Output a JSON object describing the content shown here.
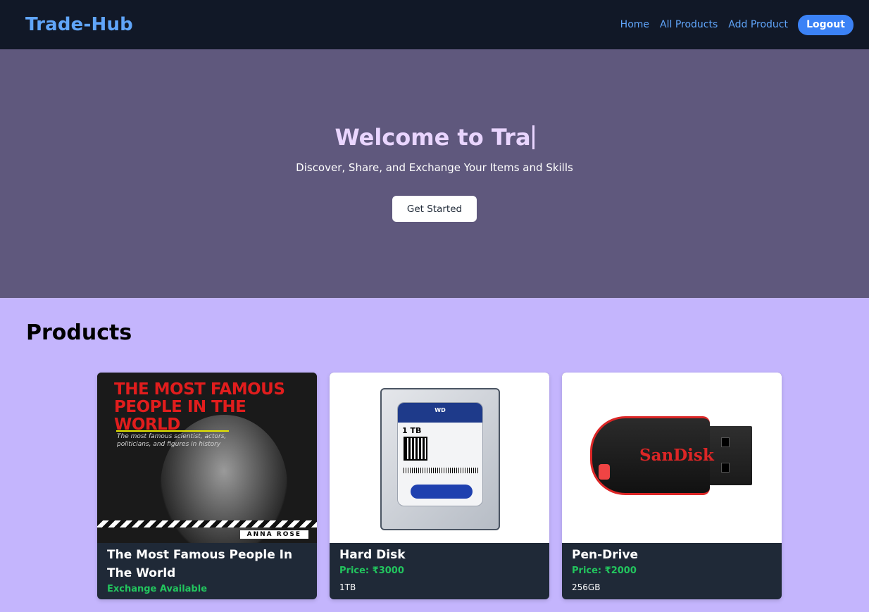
{
  "navbar": {
    "brand": "Trade-Hub",
    "links": [
      "Home",
      "All Products",
      "Add Product"
    ],
    "logout_label": "Logout"
  },
  "hero": {
    "title": "Welcome to Tra",
    "subtitle": "Discover, Share, and Exchange Your Items and Skills",
    "cta_label": "Get Started"
  },
  "products": {
    "heading": "Products",
    "items": [
      {
        "title": "The Most Famous People In The World",
        "status": "Exchange Available",
        "cover_title": "THE MOST FAMOUS PEOPLE IN THE WORLD",
        "cover_subtitle": "The most famous scientist, actors, politicians, and figures in history",
        "cover_author": "ANNA ROSE"
      },
      {
        "title": "Hard Disk",
        "price": "Price: ₹3000",
        "description": "1TB",
        "image_label_brand": "WD",
        "image_label_capacity": "1 TB"
      },
      {
        "title": "Pen-Drive",
        "price": "Price: ₹2000",
        "description": "256GB",
        "image_brand": "SanDisk"
      }
    ]
  },
  "colors": {
    "navbar_bg": "#111827",
    "brand": "#60a5fa",
    "hero_bg": "#5f587d",
    "hero_title": "#e9d5ff",
    "page_bg": "#c4b5fd",
    "card_bg": "#1f2937",
    "accent_green": "#22c55e",
    "logout_bg": "#3b82f6"
  }
}
